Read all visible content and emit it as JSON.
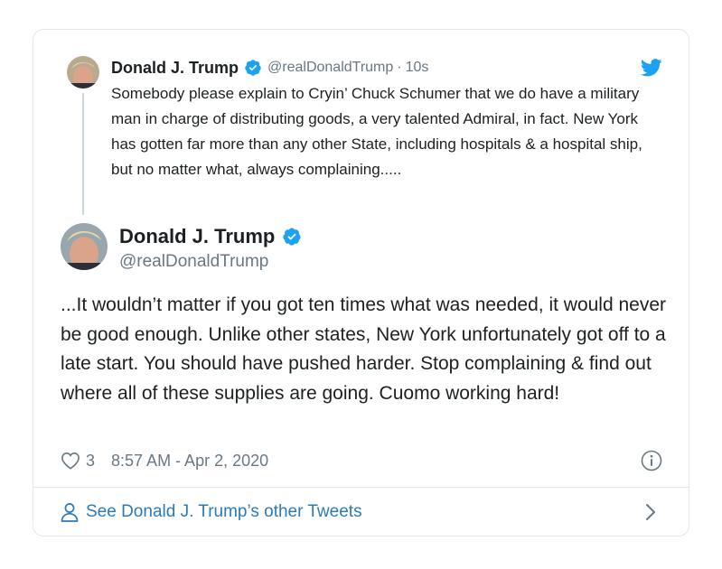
{
  "parent_tweet": {
    "name": "Donald J. Trump",
    "handle": "@realDonaldTrump",
    "separator": "·",
    "time": "10s",
    "text": "Somebody please explain to Cryin’ Chuck Schumer that we do have a military man in charge of distributing goods, a very talented Admiral, in fact. New York has gotten far more than any other State, including hospitals & a hospital ship, but no matter what, always complaining....."
  },
  "main_tweet": {
    "name": "Donald J. Trump",
    "handle": "@realDonaldTrump",
    "text": "...It wouldn’t matter if you got ten times what was needed, it would never be good enough. Unlike other states, New York unfortunately got off to a late start. You should have pushed harder. Stop complaining & find out where all of these supplies are going. Cuomo working hard!",
    "likes": "3",
    "timestamp": "8:57 AM - Apr 2, 2020"
  },
  "footer": {
    "see_more_label": "See Donald J. Trump’s other Tweets"
  },
  "icons": {
    "verified": "verified-badge-icon",
    "twitter": "twitter-bird-icon",
    "like": "heart-icon",
    "info": "info-icon",
    "person": "person-icon",
    "chevron": "chevron-right-icon"
  },
  "colors": {
    "text": "#1c2022",
    "muted": "#697882",
    "link": "#2b7bb9",
    "verified": "#1da1f2",
    "twitter_blue": "#1da1f2",
    "border": "#e1e8ed"
  }
}
